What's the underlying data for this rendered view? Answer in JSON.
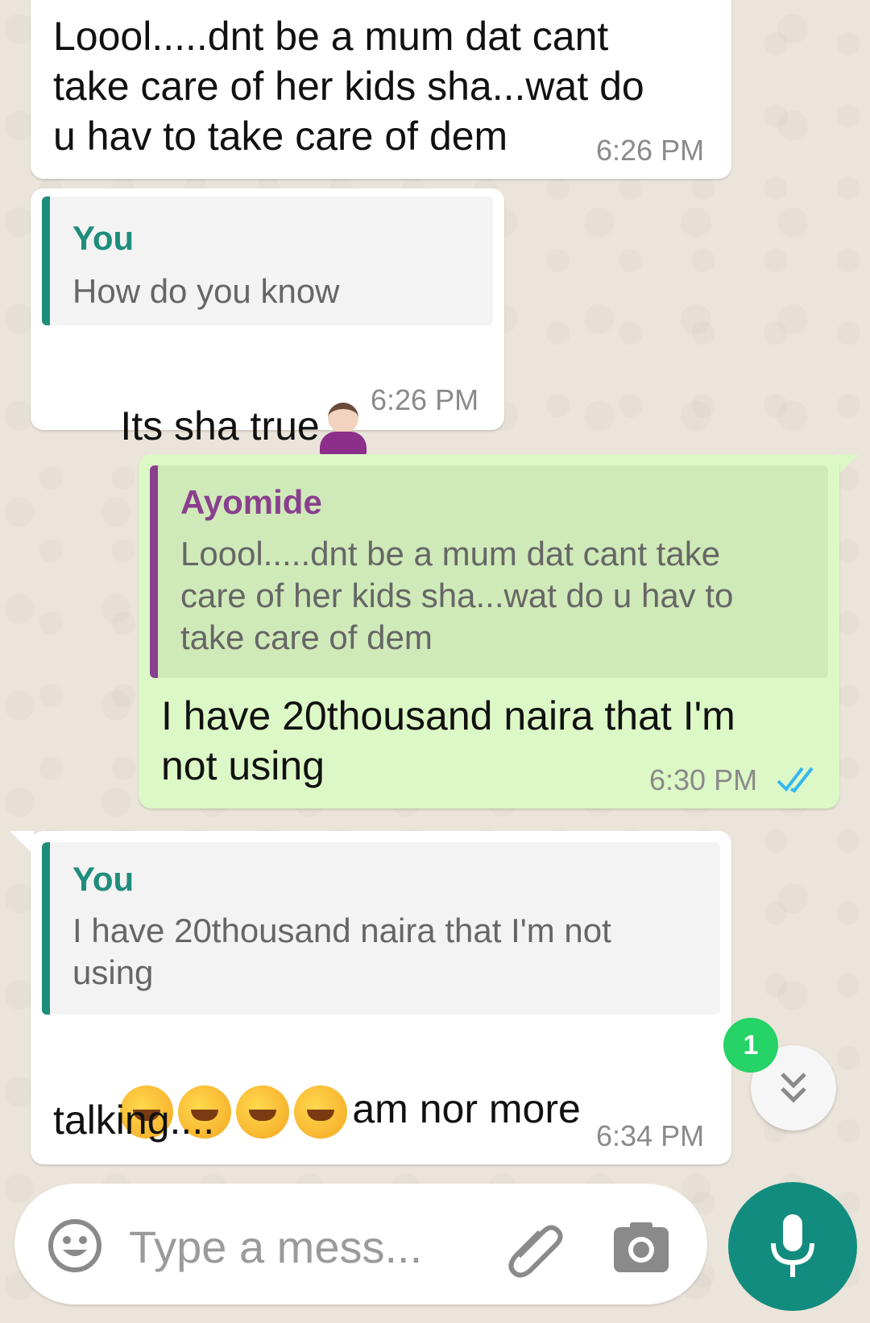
{
  "messages": [
    {
      "direction": "incoming",
      "text": "Loool.....dnt be a mum dat cant\ntake care of her kids sha...wat do\nu hav to take care of dem",
      "time": "6:26 PM"
    },
    {
      "direction": "incoming",
      "quote": {
        "author": "You",
        "text": "How do you know"
      },
      "text": "Its sha true",
      "emoji": "person-shrugging-icon",
      "time": "6:26 PM"
    },
    {
      "direction": "outgoing",
      "quote": {
        "author": "Ayomide",
        "text": "Loool.....dnt be a mum dat cant take\ncare of her kids sha...wat do u hav to\ntake care of dem"
      },
      "text": "I have 20thousand naira that I'm\nnot using",
      "time": "6:30 PM",
      "status": "read"
    },
    {
      "direction": "incoming",
      "quote": {
        "author": "You",
        "text": "I have 20thousand naira that I'm not\nusing"
      },
      "text_line1": "am nor more",
      "text_line2": "talking....",
      "emoji": "rolling-laughing-icon",
      "time": "6:34 PM"
    }
  ],
  "unread_badge": "1",
  "input": {
    "placeholder": "Type a mess..."
  },
  "colors": {
    "incoming_bg": "#ffffff",
    "outgoing_bg": "#dcf8c6",
    "quote_you": "#1f8d7b",
    "quote_ayomide": "#8a3f8f",
    "read_ticks": "#34b7f1",
    "mic_button": "#128c7e",
    "badge": "#25d366"
  }
}
